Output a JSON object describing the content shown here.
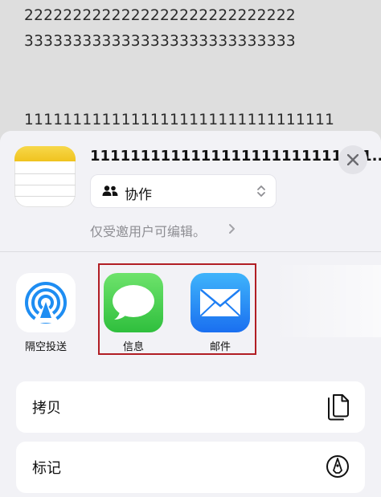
{
  "note": {
    "lines": [
      "2222222222222222222222222222",
      "3333333333333333333333333333",
      "11111111111111111111111111111111"
    ]
  },
  "share_sheet": {
    "doc_title": "1111111111111111111111111111...",
    "collab_option": "协作",
    "permission_text": "仅受邀用户可编辑。",
    "apps": [
      {
        "label": "隔空投送",
        "icon": "airdrop-icon"
      },
      {
        "label": "信息",
        "icon": "messages-icon"
      },
      {
        "label": "邮件",
        "icon": "mail-icon"
      }
    ],
    "actions": [
      {
        "label": "拷贝",
        "icon": "copy-icon"
      },
      {
        "label": "标记",
        "icon": "markup-icon"
      }
    ]
  },
  "colors": {
    "highlight_border": "#b11e24",
    "messages_green": "#2fbf3d",
    "mail_blue": "#1a6ff0",
    "airdrop_blue": "#1e8df2"
  }
}
